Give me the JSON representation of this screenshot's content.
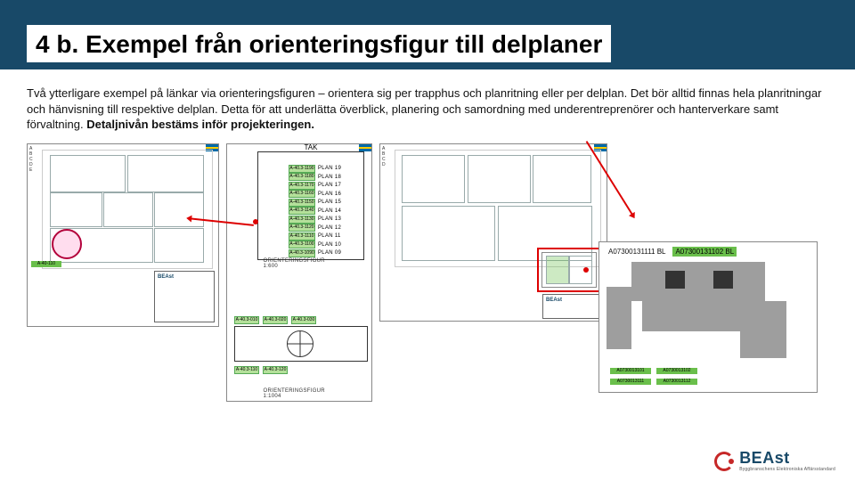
{
  "header": {
    "title": "4 b. Exempel från orienteringsfigur till delplaner"
  },
  "description": {
    "text_before_bold": "Två ytterligare exempel på länkar via orienteringsfiguren –  orientera sig per trapphus och planritning eller per delplan. Det bör alltid finnas hela planritningar och hänvisning till respektive delplan. Detta för att underlätta överblick, planering och samordning med underentreprenörer och hanterverkare samt förvaltning. ",
    "bold": "Detaljnivån bestäms inför projekteringen."
  },
  "panels": {
    "p1": {
      "titleblock_logo": "BEAst"
    },
    "p2": {
      "roof_label": "TAK",
      "plan_caption": "ORIENTERINGSFIGUR 1:600",
      "plan_list": [
        {
          "id": "A-40.3-1190",
          "label": "PLAN 19"
        },
        {
          "id": "A-40.3-1180",
          "label": "PLAN 18"
        },
        {
          "id": "A-40.3-1170",
          "label": "PLAN 17"
        },
        {
          "id": "A-40.3-1160",
          "label": "PLAN 16"
        },
        {
          "id": "A-40.3-1150",
          "label": "PLAN 15"
        },
        {
          "id": "A-40.3-1140",
          "label": "PLAN 14"
        },
        {
          "id": "A-40.3-1130",
          "label": "PLAN 13"
        },
        {
          "id": "A-40.3-1120",
          "label": "PLAN 12"
        },
        {
          "id": "A-40.3-1110",
          "label": "PLAN 11"
        },
        {
          "id": "A-40.3-1100",
          "label": "PLAN 10"
        },
        {
          "id": "A-40.3-1090",
          "label": "PLAN 09"
        }
      ],
      "bottom_tags": [
        "A-40.3-010",
        "A-40.3-020",
        "A-40.3-030"
      ],
      "bottom_tags2": [
        "A-40.3-110",
        "A-40.3-120"
      ],
      "caption2": "ORIENTERINGSFIGUR 1:1004"
    },
    "p3": {
      "titleblock_logo": "BEAst"
    },
    "p4": {
      "id_left": "A0730013111",
      "id_left_suffix": "1 BL",
      "id_right": "A07300131102 BL"
    }
  },
  "footer": {
    "brand": "BEAst",
    "tagline": "Byggbranschens Elektroniska Affärsstandard"
  }
}
